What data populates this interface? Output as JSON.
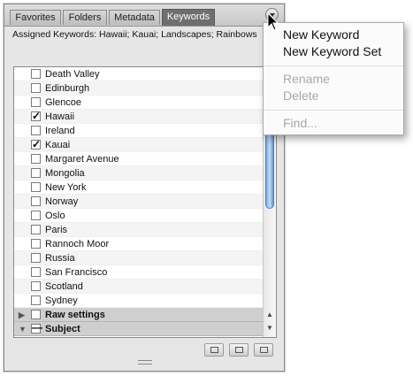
{
  "tabs": [
    {
      "label": "Favorites"
    },
    {
      "label": "Folders"
    },
    {
      "label": "Metadata"
    },
    {
      "label": "Keywords",
      "active": true
    }
  ],
  "assigned_keywords": "Assigned Keywords: Hawaii; Kauai; Landscapes; Rainbows",
  "keywords": [
    {
      "label": "Death Valley",
      "checked": false
    },
    {
      "label": "Edinburgh",
      "checked": false
    },
    {
      "label": "Glencoe",
      "checked": false
    },
    {
      "label": "Hawaii",
      "checked": true
    },
    {
      "label": "Ireland",
      "checked": false
    },
    {
      "label": "Kauai",
      "checked": true
    },
    {
      "label": "Margaret Avenue",
      "checked": false
    },
    {
      "label": "Mongolia",
      "checked": false
    },
    {
      "label": "New York",
      "checked": false
    },
    {
      "label": "Norway",
      "checked": false
    },
    {
      "label": "Oslo",
      "checked": false
    },
    {
      "label": "Paris",
      "checked": false
    },
    {
      "label": "Rannoch Moor",
      "checked": false
    },
    {
      "label": "Russia",
      "checked": false
    },
    {
      "label": "San Francisco",
      "checked": false
    },
    {
      "label": "Scotland",
      "checked": false
    },
    {
      "label": "Sydney",
      "checked": false
    }
  ],
  "groups": [
    {
      "label": "Raw settings",
      "expanded": false
    },
    {
      "label": "Subject",
      "expanded": true
    }
  ],
  "glyphs": {
    "check": "✓",
    "dash": "—",
    "tri_right": "▶",
    "tri_down": "▼",
    "arrow_up": "▲",
    "arrow_down": "▼"
  },
  "menu": {
    "new_keyword": "New Keyword",
    "new_keyword_set": "New Keyword Set",
    "rename": "Rename",
    "delete": "Delete",
    "find": "Find..."
  },
  "colors": {
    "active_tab": "#6f6f6f",
    "scroll_thumb": "#7aa7e0",
    "disabled_text": "#a8a8a8"
  }
}
